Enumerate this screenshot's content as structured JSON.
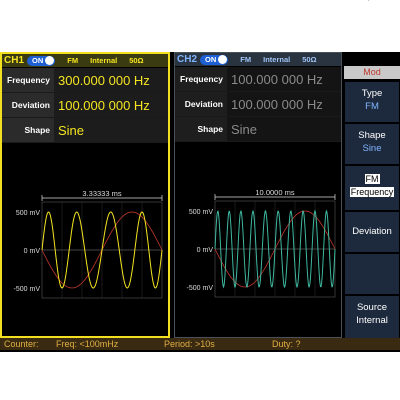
{
  "ch1": {
    "name": "CH1",
    "state": "ON",
    "mode": "FM",
    "source": "Internal",
    "impedance": "50Ω",
    "params": [
      {
        "label": "Frequency",
        "value": "300.000 000 Hz"
      },
      {
        "label": "Deviation",
        "value": "100.000 000 Hz"
      },
      {
        "label": "Shape",
        "value": "Sine"
      }
    ],
    "period_marker": "3.33333 ms",
    "y_axis": [
      "500 mV",
      "0 mV",
      "-500 mV"
    ]
  },
  "ch2": {
    "name": "CH2",
    "state": "ON",
    "mode": "FM",
    "source": "Internal",
    "impedance": "50Ω",
    "params": [
      {
        "label": "Frequency",
        "value": "100.000 000 Hz"
      },
      {
        "label": "Deviation",
        "value": "100.000 000 Hz"
      },
      {
        "label": "Shape",
        "value": "Sine"
      }
    ],
    "period_marker": "10.0000 ms",
    "y_axis": [
      "500 mV",
      "0 mV",
      "-500 mV"
    ]
  },
  "menu": {
    "title": "Mod",
    "type_label": "Type",
    "type_value": "FM",
    "shape_label": "Shape",
    "shape_value": "Sine",
    "fm_label": "FM",
    "frequency_label": "Frequency",
    "deviation_label": "Deviation",
    "source_label": "Source",
    "source_value": "Internal"
  },
  "status": {
    "counter": "Counter:",
    "freq": "Freq: <100mHz",
    "period": "Period: >10s",
    "duty": "Duty: ?"
  },
  "icons": {
    "usb": "usb-icon"
  },
  "colors": {
    "ch1": "#f5e521",
    "ch2": "#7fb4ff",
    "mod_trace": "#c0392b",
    "ch2_trace": "#3fb8a0"
  }
}
